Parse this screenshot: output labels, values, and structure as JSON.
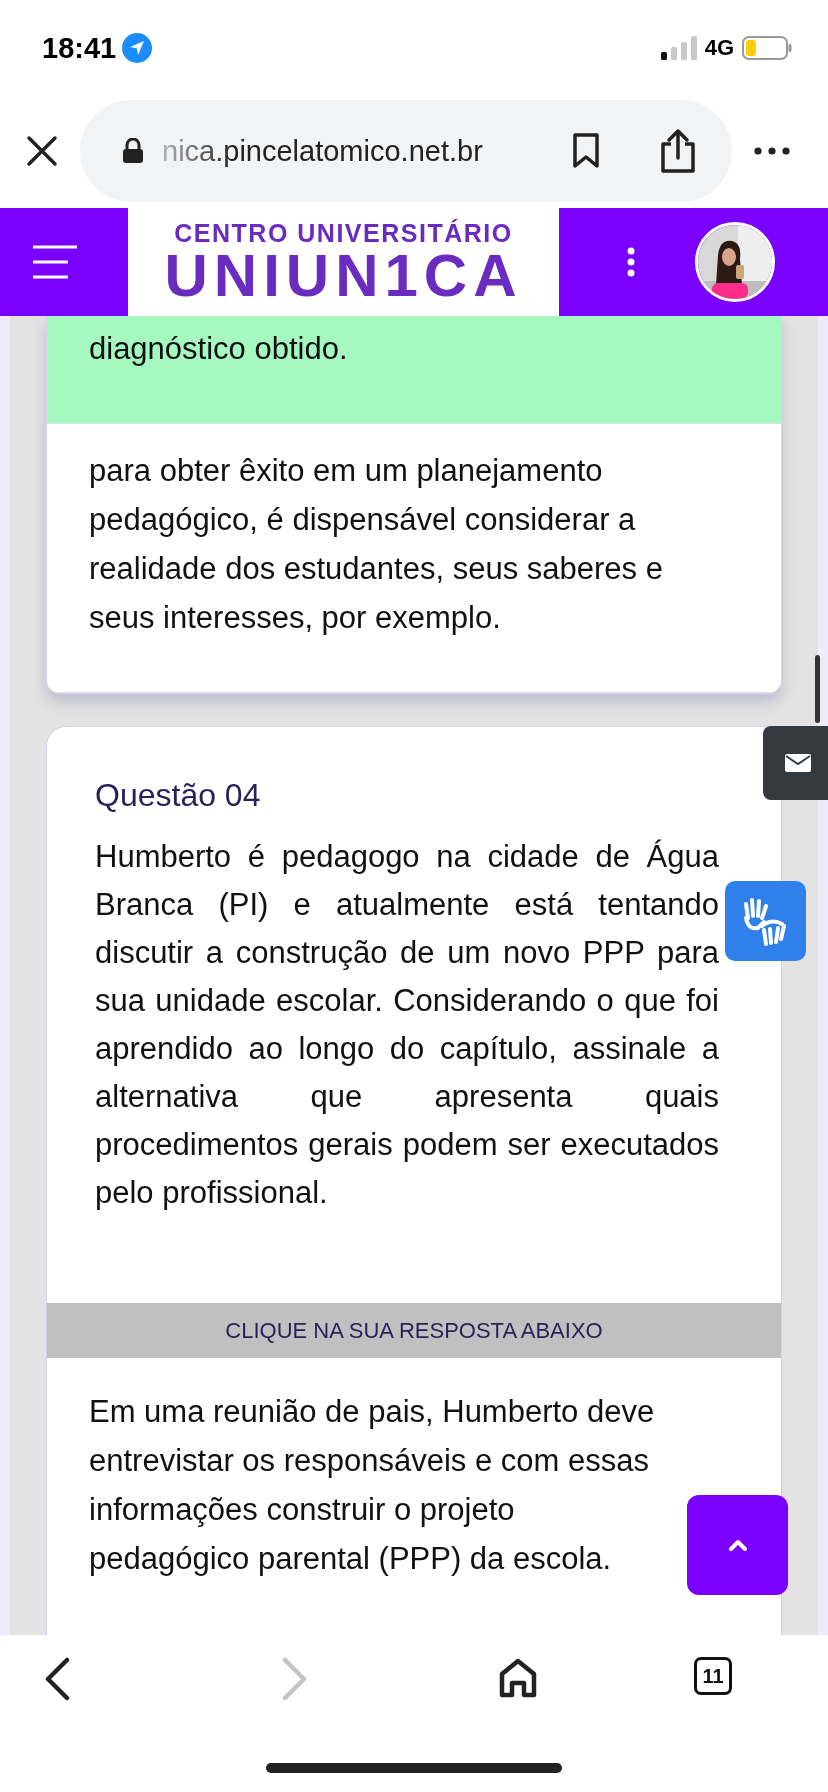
{
  "status_bar": {
    "time": "18:41",
    "network": "4G"
  },
  "browser": {
    "url": "nica.pincelatomico.net.br",
    "tab_count": "11"
  },
  "header": {
    "logo_subtitle": "CENTRO UNIVERSITÁRIO",
    "logo_name": "UNIUN1CA"
  },
  "previous_question": {
    "options": [
      {
        "text": "diagnóstico obtido.",
        "selected": true
      },
      {
        "text": "para obter êxito em um planejamento pedagógico, é dispensável considerar a realidade dos estudantes, seus saberes e seus interesses, por exemplo.",
        "selected": false
      }
    ]
  },
  "question": {
    "title": "Questão 04",
    "text": "Humberto é pedagogo na cidade de Água Branca (PI) e atualmente está tentando discutir a construção de um novo PPP para sua unidade escolar. Considerando o que foi aprendido ao longo do capítulo, assinale a alternativa que apresenta quais procedimentos gerais podem ser executados pelo profissional.",
    "instruction": "CLIQUE NA SUA RESPOSTA ABAIXO",
    "options": [
      {
        "text": "Em uma reunião de pais, Humberto deve entrevistar os responsáveis e com essas informações construir o projeto pedagógico parental (PPP) da escola.",
        "selected": false
      }
    ]
  }
}
